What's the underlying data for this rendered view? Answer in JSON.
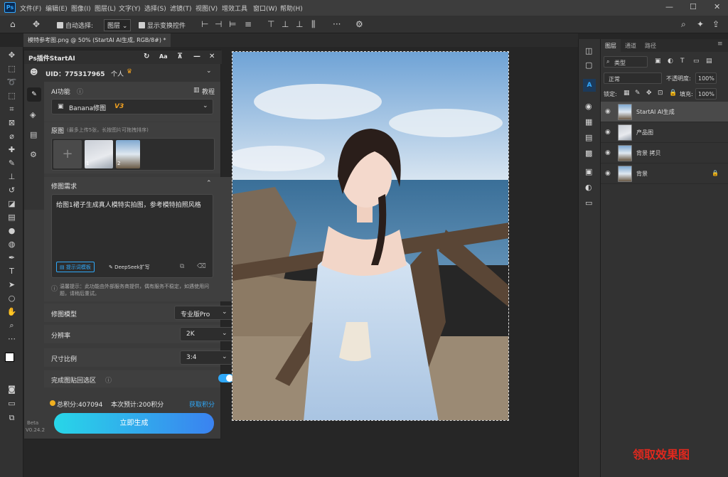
{
  "app": {
    "logo": "Ps"
  },
  "menu": [
    "文件(F)",
    "编辑(E)",
    "图像(I)",
    "图层(L)",
    "文字(Y)",
    "选择(S)",
    "滤镜(T)",
    "视图(V)",
    "增效工具",
    "窗口(W)",
    "帮助(H)"
  ],
  "options": {
    "auto_select_label": "自动选择:",
    "auto_select_value": "图层",
    "show_transform_label": "显示变换控件"
  },
  "doc_tab": {
    "title": "模特参考图.png @ 50% (StartAI AI生成, RGB/8#) *"
  },
  "plugin": {
    "title": "Ps插件StartAI",
    "uid_label": "UID：775317965",
    "account_type": "个人",
    "ai_function_label": "AI功能",
    "tutorial": "教程",
    "function_value": "Banana修图",
    "function_version": "V3",
    "source_label": "原图",
    "source_hint": "(最多上传5张，长按图片可拖拽排序)",
    "source_numbers": [
      "1",
      "2"
    ],
    "requirement_label": "修图需求",
    "requirement_text": "给图1裙子生成真人模特实拍图，参考模特拍照风格",
    "prompt_template": "提示词模板",
    "deepseek": "DeepSeek扩写",
    "notice": "温馨提示：此功能由外部服务商提供，偶有服务不稳定，如遇使用问题，请稍后重试。",
    "model_label": "修图模型",
    "model_value": "专业版Pro",
    "resolution_label": "分辨率",
    "resolution_value": "2K",
    "ratio_label": "尺寸比例",
    "ratio_value": "3:4",
    "paste_back_label": "完成图贴回选区",
    "total_points": "总积分:407094",
    "estimate": "本次预计:200积分",
    "get_points": "获取积分",
    "generate": "立即生成",
    "beta": "Beta",
    "version": "V0.24.2"
  },
  "layers_panel": {
    "tabs": [
      "图层",
      "通道",
      "路径"
    ],
    "filter": "类型",
    "blend": "正常",
    "opacity_label": "不透明度:",
    "opacity_value": "100%",
    "lock_label": "锁定:",
    "fill_label": "填充:",
    "fill_value": "100%",
    "layers": [
      "StartAI AI生成",
      "产品图",
      "背景 拷贝",
      "背景"
    ]
  },
  "watermark": "领取效果图",
  "colors": {
    "accent": "#31a8ff",
    "generate_start": "#28d6e8",
    "generate_end": "#3a82f0",
    "toggle": "#2fa8f8",
    "watermark": "#e0281e",
    "version_tag": "#f0a020"
  }
}
